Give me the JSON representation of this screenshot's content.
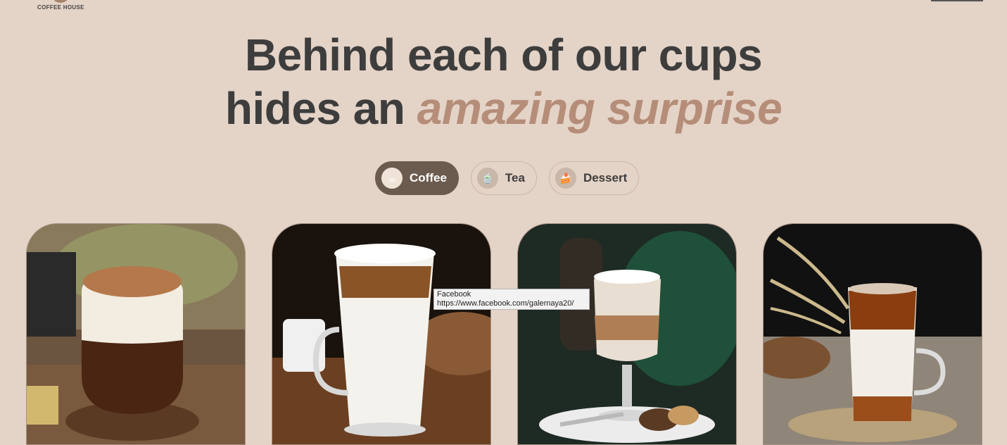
{
  "header": {
    "logo_text": "COFFEE HOUSE"
  },
  "hero": {
    "line1": "Behind each of our cups",
    "line2_plain": "hides an",
    "line2_accent": "amazing surprise"
  },
  "tabs": [
    {
      "label": "Coffee",
      "icon": "coffee-cup-icon",
      "emoji": "☕",
      "active": true
    },
    {
      "label": "Tea",
      "icon": "teapot-icon",
      "emoji": "🍵",
      "active": false
    },
    {
      "label": "Dessert",
      "icon": "cake-icon",
      "emoji": "🍰",
      "active": false
    }
  ],
  "colors": {
    "background": "#e4d3c7",
    "heading": "#3d3d3d",
    "accent": "#b58d78",
    "active_tab": "#6b5b4f"
  },
  "tooltip": {
    "title": "Facebook",
    "url": "https://www.facebook.com/galernaya20/"
  }
}
